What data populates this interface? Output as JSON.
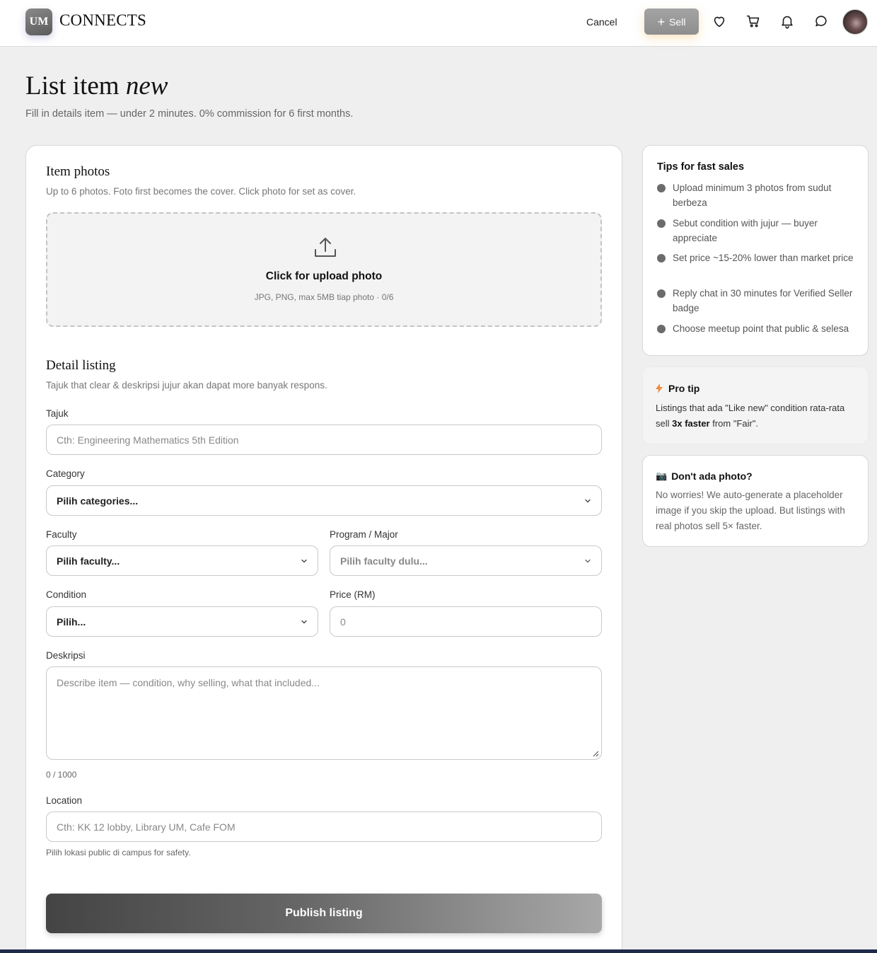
{
  "header": {
    "logo_badge": "UM",
    "logo_text": "CONNECTS",
    "cancel_label": "Cancel",
    "sell_label": "Sell",
    "icons": [
      "heart-icon",
      "cart-icon",
      "bell-icon",
      "chat-icon"
    ]
  },
  "page": {
    "title_main": "List item",
    "title_em": "new",
    "subtitle": "Fill in details item — under 2 minutes. 0% commission for 6 first months."
  },
  "photos": {
    "title": "Item photos",
    "subtitle": "Up to 6 photos. Foto first becomes the cover. Click photo for set as cover.",
    "upload_title": "Click for upload photo",
    "upload_hint": "JPG, PNG, max 5MB tiap photo · 0/6"
  },
  "details": {
    "title": "Detail listing",
    "subtitle": "Tajuk that clear & deskripsi jujur akan dapat more banyak respons.",
    "tajuk_label": "Tajuk",
    "tajuk_placeholder": "Cth: Engineering Mathematics 5th Edition",
    "category_label": "Category",
    "category_value": "Pilih categories...",
    "faculty_label": "Faculty",
    "faculty_value": "Pilih faculty...",
    "program_label": "Program / Major",
    "program_value": "Pilih faculty dulu...",
    "condition_label": "Condition",
    "condition_value": "Pilih...",
    "price_label": "Price (RM)",
    "price_placeholder": "0",
    "desc_label": "Deskripsi",
    "desc_placeholder": "Describe item — condition, why selling, what that included...",
    "desc_counter": "0 / 1000",
    "location_label": "Location",
    "location_placeholder": "Cth: KK 12 lobby, Library UM, Cafe FOM",
    "location_note": "Pilih lokasi public di campus for safety.",
    "publish_label": "Publish listing"
  },
  "tips": {
    "title": "Tips for fast sales",
    "items": [
      "Upload minimum 3 photos from sudut berbeza",
      "Sebut condition with jujur — buyer appreciate",
      "Set price ~15-20% lower than market price",
      "Reply chat in 30 minutes for Verified Seller badge",
      "Choose meetup point that public & selesa"
    ]
  },
  "protip": {
    "title": "Pro tip",
    "body_before": "Listings that ada \"Like new\" condition rata-rata sell ",
    "body_bold": "3x faster",
    "body_after": " from \"Fair\"."
  },
  "nophoto": {
    "emoji": "📷",
    "title": "Don't ada photo?",
    "body": "No worries! We auto-generate a placeholder image if you skip the upload. But listings with real photos sell 5× faster."
  },
  "colors": {
    "accent_orange": "#f08a3c",
    "publish_dark": "#444444",
    "page_bg": "#efefef"
  }
}
